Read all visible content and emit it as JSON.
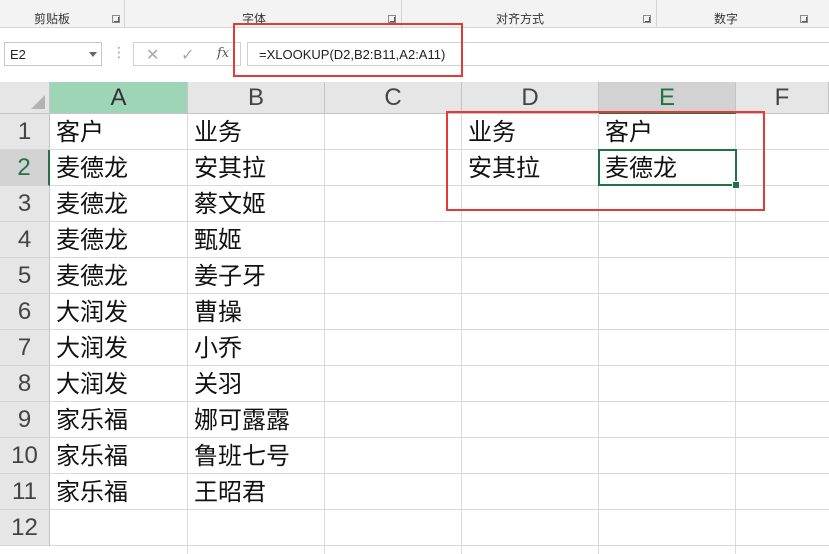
{
  "ribbon": {
    "groups": [
      {
        "label": "剪贴板"
      },
      {
        "label": "字体"
      },
      {
        "label": "对齐方式"
      },
      {
        "label": "数字"
      }
    ]
  },
  "formula_bar": {
    "name_box": "E2",
    "cancel_icon": "✕",
    "enter_icon": "✓",
    "fx_label": "fx",
    "formula": "=XLOOKUP(D2,B2:B11,A2:A11)"
  },
  "sheet": {
    "columns": [
      "A",
      "B",
      "C",
      "D",
      "E",
      "F"
    ],
    "rows": [
      "1",
      "2",
      "3",
      "4",
      "5",
      "6",
      "7",
      "8",
      "9",
      "10",
      "11",
      "12"
    ],
    "col_a": [
      "客户",
      "麦德龙",
      "麦德龙",
      "麦德龙",
      "麦德龙",
      "大润发",
      "大润发",
      "大润发",
      "家乐福",
      "家乐福",
      "家乐福"
    ],
    "col_b": [
      "业务",
      "安其拉",
      "蔡文姬",
      "甄姬",
      "姜子牙",
      "曹操",
      "小乔",
      "关羽",
      "娜可露露",
      "鲁班七号",
      "王昭君"
    ],
    "lookup": {
      "d1": "业务",
      "e1": "客户",
      "d2": "安其拉",
      "e2": "麦德龙"
    },
    "active_cell": "E2"
  },
  "colors": {
    "accent": "#217346",
    "annotation": "#e53935",
    "header_bg": "#e6e6e6"
  }
}
